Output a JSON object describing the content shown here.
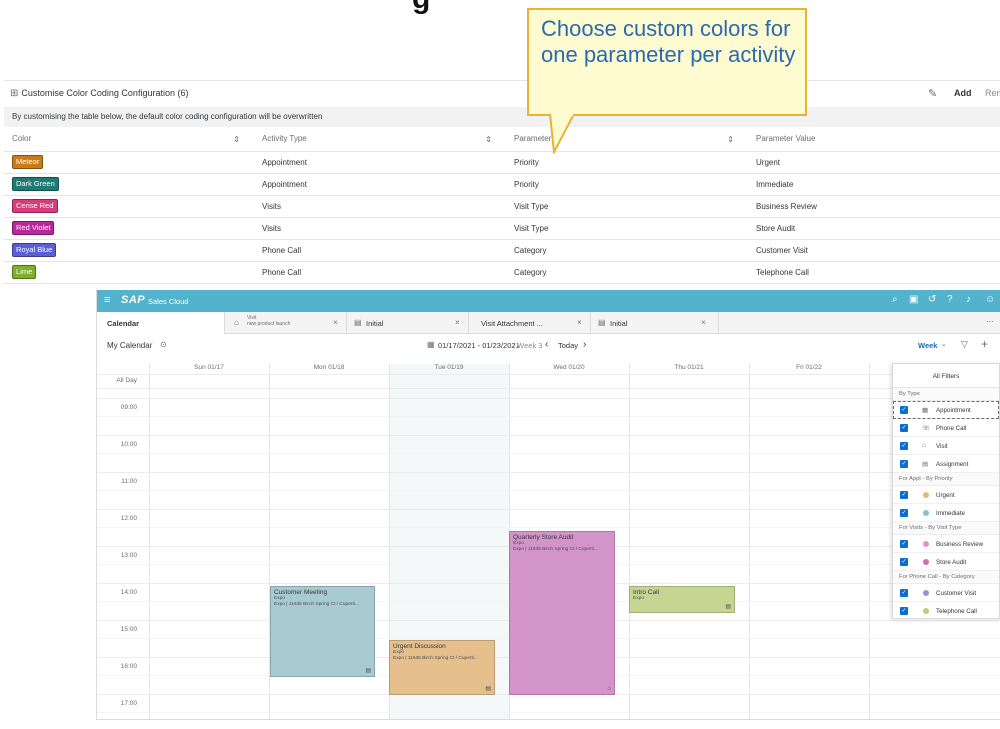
{
  "heading_fragment": "g",
  "callout": {
    "text": "Choose custom colors for one parameter per activity"
  },
  "config": {
    "title": "Customise Color Coding Configuration  (6)",
    "add_label": "Add",
    "remove_label": "Rem",
    "info": "By customising the table below, the default color coding configuration will be overwritten",
    "columns": [
      "Color",
      "Activity Type",
      "Parameter",
      "Parameter Value"
    ],
    "rows": [
      {
        "color_label": "Meteor",
        "color_hex": "#c87b1b",
        "activity": "Appointment",
        "parameter": "Priority",
        "value": "Urgent"
      },
      {
        "color_label": "Dark Green",
        "color_hex": "#1f7a72",
        "activity": "Appointment",
        "parameter": "Priority",
        "value": "Immediate"
      },
      {
        "color_label": "Cerise Red",
        "color_hex": "#d93c7a",
        "activity": "Visits",
        "parameter": "Visit Type",
        "value": "Business Review"
      },
      {
        "color_label": "Red Violet",
        "color_hex": "#b8289b",
        "activity": "Visits",
        "parameter": "Visit Type",
        "value": "Store Audit"
      },
      {
        "color_label": "Royal Blue",
        "color_hex": "#5b5fd6",
        "activity": "Phone Call",
        "parameter": "Category",
        "value": "Customer Visit"
      },
      {
        "color_label": "Lime",
        "color_hex": "#7fb02c",
        "activity": "Phone Call",
        "parameter": "Category",
        "value": "Telephone Call"
      }
    ]
  },
  "app": {
    "logo": "SAP",
    "name": "Sales Cloud",
    "tabs": [
      {
        "label": "Calendar"
      },
      {
        "sub1": "Visit",
        "sub2": "new product launch"
      },
      {
        "label": "Initial"
      },
      {
        "label": "Visit Attachment ..."
      },
      {
        "label": "Initial"
      }
    ],
    "toolbar": {
      "title": "My Calendar",
      "range": "01/17/2021 - 01/23/2021",
      "week": "/ Week 3",
      "today": "Today",
      "view": "Week"
    },
    "days": [
      "Sun 01/17",
      "Mon 01/18",
      "Tue 01/19",
      "Wed 01/20",
      "Thu 01/21",
      "Fri 01/22"
    ],
    "all_day": "All Day",
    "times": [
      "09:00",
      "10:00",
      "11:00",
      "12:00",
      "13:00",
      "14:00",
      "15:00",
      "16:00",
      "17:00"
    ],
    "events": [
      {
        "title": "Customer Meeting",
        "line1": "Expo",
        "line2": "Expo | 11635 Birch Spring Ct / Cuperti...",
        "color": "#a8cad1"
      },
      {
        "title": "Urgent Discussion",
        "line1": "Expo",
        "line2": "Expo | 11635 Birch Spring Ct / Cuperti...",
        "color": "#e6c08c"
      },
      {
        "title": "Quarterly Store Audit",
        "line1": "Expo",
        "line2": "Expo | 11635 Birch Spring Ct / Cuperti...",
        "color": "#d394c9"
      },
      {
        "title": "Intro Call",
        "line1": "Expo",
        "line2": "",
        "color": "#c6d592"
      }
    ],
    "filters": {
      "title": "All Filters",
      "groups": [
        {
          "label": "By Type",
          "items": [
            {
              "label": "Appointment",
              "icon": "calendar-icon"
            },
            {
              "label": "Phone Call",
              "icon": "phone-icon"
            },
            {
              "label": "Visit",
              "icon": "visit-icon"
            },
            {
              "label": "Assignment",
              "icon": "task-icon"
            }
          ]
        },
        {
          "label": "For Appt - By Priority",
          "items": [
            {
              "label": "Urgent",
              "dot": "#e6b87a"
            },
            {
              "label": "Immediate",
              "dot": "#8fbfca"
            }
          ]
        },
        {
          "label": "For Visits - By Visit Type",
          "items": [
            {
              "label": "Business Review",
              "dot": "#e48fc7"
            },
            {
              "label": "Store Audit",
              "dot": "#c873b4"
            }
          ]
        },
        {
          "label": "For Phone Call - By Category",
          "items": [
            {
              "label": "Customer Visit",
              "dot": "#8f93e0"
            },
            {
              "label": "Telephone Call",
              "dot": "#b4d07a"
            }
          ]
        }
      ]
    }
  }
}
